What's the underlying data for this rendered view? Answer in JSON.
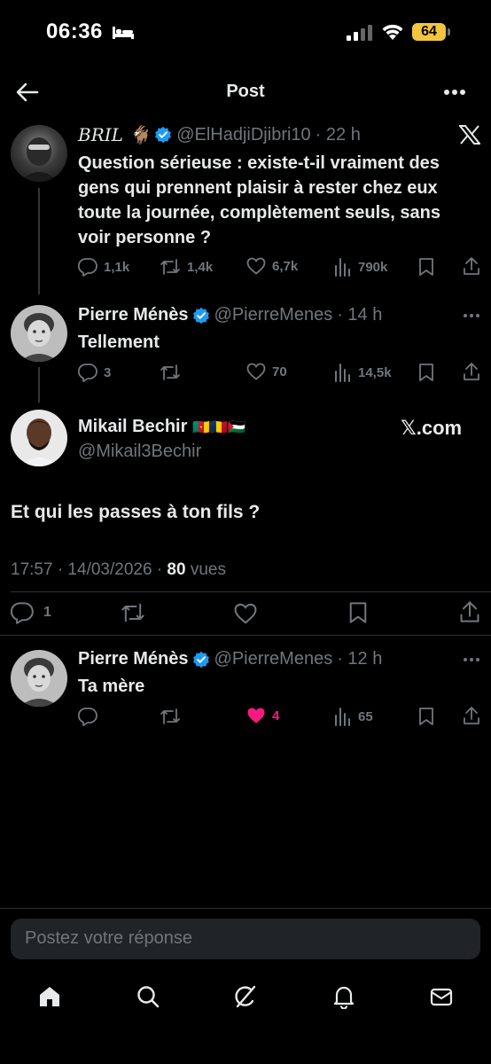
{
  "status_bar": {
    "time": "06:36",
    "battery": "64"
  },
  "header": {
    "title": "Post"
  },
  "tweets": [
    {
      "name": "BRIL 🐐",
      "handle": "@ElHadjiDjibri10",
      "time": "· 22 h",
      "text": "Question sérieuse : existe-t-il vraiment des gens qui prennent plaisir à rester chez eux toute la journée, complètement seuls, sans voir personne ?",
      "replies": "1,1k",
      "reposts": "1,4k",
      "likes": "6,7k",
      "views": "790k"
    },
    {
      "name": "Pierre Ménès",
      "handle": "@PierreMenes",
      "time": "· 14 h",
      "text": "Tellement",
      "replies": "3",
      "reposts": "",
      "likes": "70",
      "views": "14,5k"
    }
  ],
  "main_post": {
    "name": "Mikail Bechir",
    "flags": "🇨🇲🇹🇩🇵🇸",
    "handle": "@Mikail3Bechir",
    "watermark": "𝕏.com",
    "text": "Et qui les passes à ton fils ?",
    "timestamp": "17:57 · 14/03/2026 · ",
    "views_count": "80",
    "views_label": " vues",
    "replies": "1"
  },
  "reply": {
    "name": "Pierre Ménès",
    "handle": "@PierreMenes",
    "time": "· 12 h",
    "text": "Ta mère",
    "likes": "4",
    "views": "65"
  },
  "composer": {
    "placeholder": "Postez votre réponse"
  },
  "colors": {
    "verified": "#1d9bf0",
    "like_active": "#f91880",
    "battery": "#f2c53d"
  },
  "icons": [
    "back-icon",
    "more-icon",
    "x-logo-icon",
    "reply-icon",
    "repost-icon",
    "like-icon",
    "views-icon",
    "bookmark-icon",
    "share-icon",
    "home-icon",
    "search-icon",
    "grok-icon",
    "bell-icon",
    "mail-icon"
  ]
}
